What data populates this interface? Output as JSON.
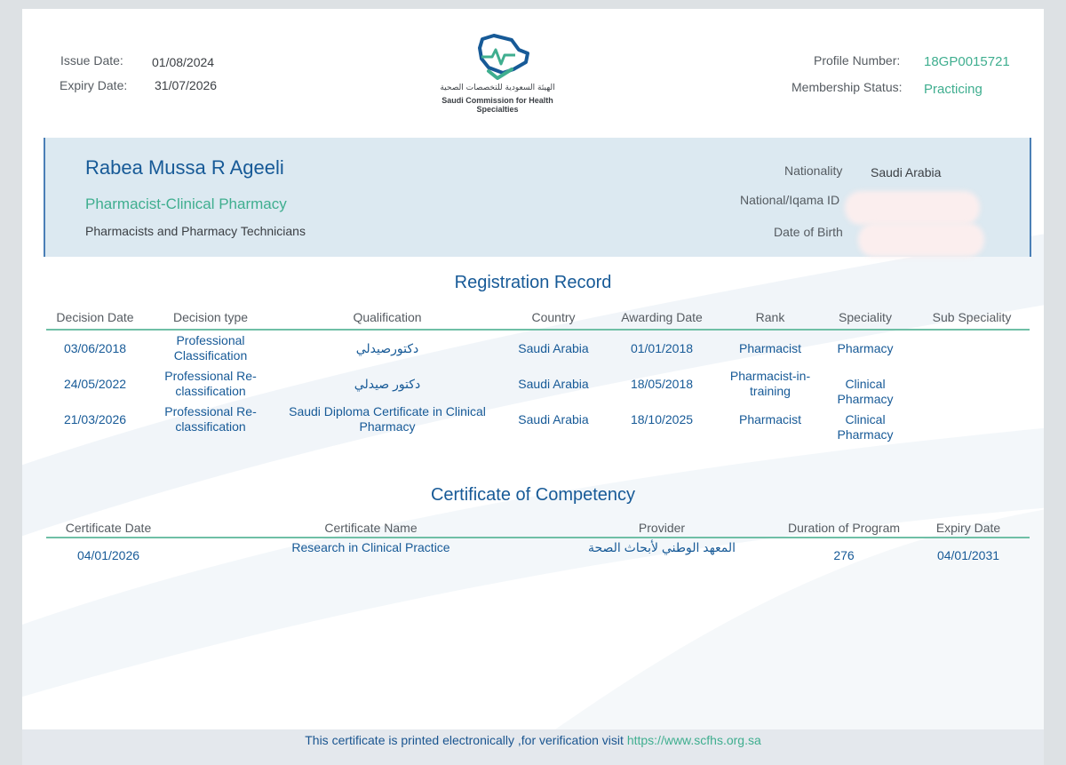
{
  "header": {
    "issue_date_label": "Issue Date:",
    "issue_date": "01/08/2024",
    "expiry_date_label": "Expiry Date:",
    "expiry_date": "31/07/2026",
    "profile_number_label": "Profile Number:",
    "profile_number": "18GP0015721",
    "membership_status_label": "Membership Status:",
    "membership_status": "Practicing"
  },
  "logo": {
    "arabic_name": "الهيئة السعودية للتخصصات الصحية",
    "english_name": "Saudi Commission for Health Specialties"
  },
  "profile": {
    "name": "Rabea Mussa R Ageeli",
    "title": "Pharmacist-Clinical Pharmacy",
    "category": "Pharmacists and Pharmacy Technicians",
    "nationality_label": "Nationality",
    "nationality": "Saudi Arabia",
    "national_id_label": "National/Iqama ID",
    "dob_label": "Date of Birth"
  },
  "registration": {
    "title": "Registration Record",
    "columns": [
      "Decision Date",
      "Decision type",
      "Qualification",
      "Country",
      "Awarding Date",
      "Rank",
      "Speciality",
      "Sub Speciality"
    ],
    "rows": [
      [
        "03/06/2018",
        "Professional Classification",
        "دكتورصيدلي",
        "Saudi Arabia",
        "01/01/2018",
        "Pharmacist",
        "Pharmacy",
        ""
      ],
      [
        "24/05/2022",
        "Professional Re-classification",
        "دكتور صيدلي",
        "Saudi Arabia",
        "18/05/2018",
        "Pharmacist-in-training",
        "Clinical Pharmacy",
        ""
      ],
      [
        "21/03/2026",
        "Professional Re-classification",
        "Saudi Diploma Certificate in Clinical Pharmacy",
        "Saudi Arabia",
        "18/10/2025",
        "Pharmacist",
        "Clinical Pharmacy",
        ""
      ]
    ]
  },
  "competency": {
    "title": "Certificate of Competency",
    "columns": [
      "Certificate Date",
      "Certificate Name",
      "Provider",
      "Duration of Program",
      "Expiry Date"
    ],
    "rows": [
      [
        "04/01/2026",
        "Research in Clinical Practice",
        "المعهد الوطني لأبحاث الصحة",
        "276",
        "04/01/2031"
      ]
    ]
  },
  "footer": {
    "text": "This certificate is printed electronically ,for verification visit",
    "link": "https://www.scfhs.org.sa"
  },
  "colors": {
    "brand_blue": "#175a97",
    "brand_teal": "#3fae8f",
    "info_box_bg": "#dce9f1"
  }
}
